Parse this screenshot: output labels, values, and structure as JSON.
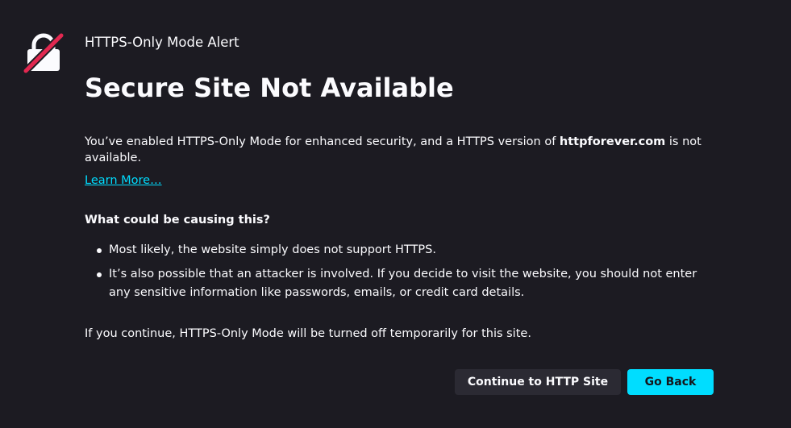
{
  "alert": {
    "eyebrow": "HTTPS-Only Mode Alert",
    "title": "Secure Site Not Available",
    "intro_prefix": "You’ve enabled HTTPS-Only Mode for enhanced security, and a HTTPS version of ",
    "site": "httpforever.com",
    "intro_suffix": " is not available.",
    "learn_more": "Learn More…",
    "causes_heading": "What could be causing this?",
    "causes": [
      "Most likely, the website simply does not support HTTPS.",
      "It’s also possible that an attacker is involved. If you decide to visit the website, you should not enter any sensitive information like passwords, emails, or credit card details."
    ],
    "continue_note": "If you continue, HTTPS-Only Mode will be turned off temporarily for this site."
  },
  "buttons": {
    "continue": "Continue to HTTP Site",
    "back": "Go Back"
  },
  "icons": {
    "lock": "broken-lock-icon"
  },
  "colors": {
    "background": "#1c1b22",
    "text": "#fbfbfe",
    "link": "#00ddff",
    "primary_button": "#00ddff",
    "secondary_button": "#2b2a33",
    "slash": "#e22850"
  }
}
